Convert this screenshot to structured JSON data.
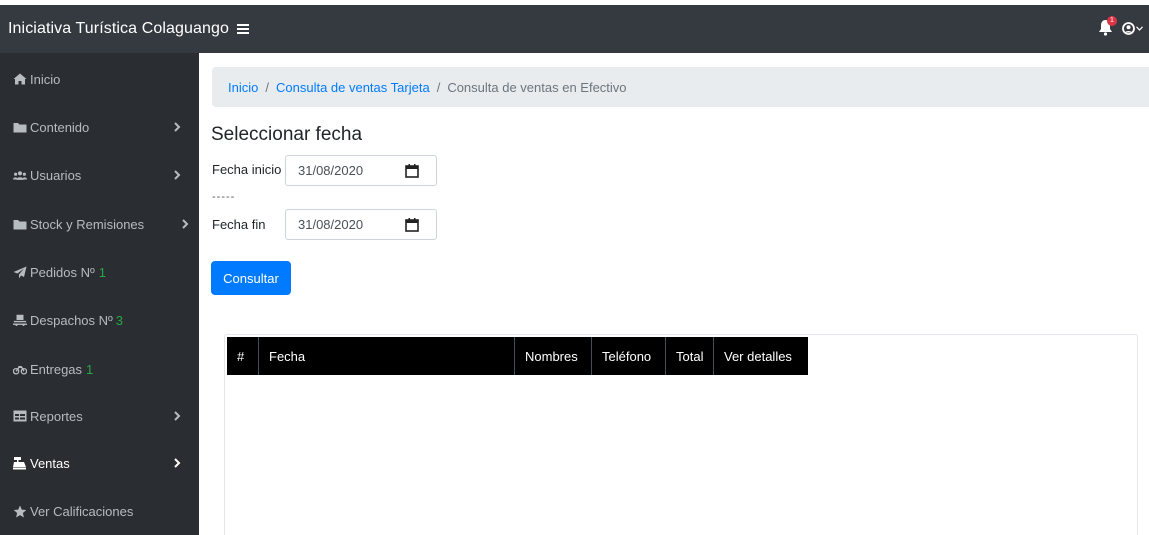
{
  "app": {
    "title": "Iniciativa Turística Colaguango",
    "menu_icon": "hamburger-icon",
    "notification_icon": "bell-icon",
    "notification_count": "1",
    "user_icon": "user-circle-icon"
  },
  "sidebar": {
    "items": [
      {
        "label": "Inicio",
        "icon": "home-icon",
        "count": "",
        "has_submenu": false
      },
      {
        "label": "Contenido",
        "icon": "folder-icon",
        "count": "",
        "has_submenu": true
      },
      {
        "label": "Usuarios",
        "icon": "users-icon",
        "count": "",
        "has_submenu": true
      },
      {
        "label": "Stock y Remisiones",
        "icon": "folder-icon",
        "count": "",
        "has_submenu": true
      },
      {
        "label": "Pedidos Nº",
        "icon": "paper-plane-icon",
        "count": "1",
        "has_submenu": false
      },
      {
        "label": "Despachos Nº",
        "icon": "dolly-icon",
        "count": "3",
        "has_submenu": false
      },
      {
        "label": "Entregas",
        "icon": "motorcycle-icon",
        "count": "1",
        "has_submenu": false
      },
      {
        "label": "Reportes",
        "icon": "table-icon",
        "count": "",
        "has_submenu": true
      },
      {
        "label": "Ventas",
        "icon": "cash-register-icon",
        "count": "",
        "has_submenu": true,
        "active": true
      },
      {
        "label": "Ver Calificaciones",
        "icon": "star-icon",
        "count": "",
        "has_submenu": false
      }
    ]
  },
  "breadcrumb": {
    "items": [
      "Inicio",
      "Consulta de ventas Tarjeta"
    ],
    "current": "Consulta de ventas en Efectivo",
    "separator": "/"
  },
  "form": {
    "title": "Seleccionar fecha",
    "start_label": "Fecha inicio",
    "start_value": "31/08/2020",
    "divider": "-----",
    "end_label": "Fecha fin",
    "end_value": "31/08/2020",
    "submit_label": "Consultar"
  },
  "table": {
    "columns": [
      "#",
      "Fecha",
      "Nombres",
      "Teléfono",
      "Total",
      "Ver detalles"
    ],
    "rows": []
  },
  "colors": {
    "topbar": "#343a40",
    "sidebar": "#2a2d31",
    "primary": "#007bff",
    "count_green": "#28a745",
    "badge_red": "#dc3545"
  }
}
